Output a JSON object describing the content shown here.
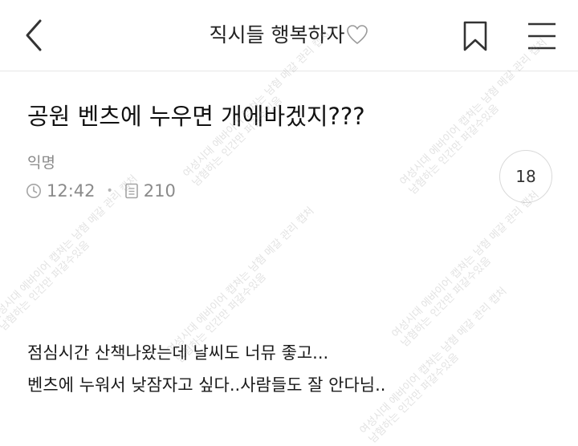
{
  "header": {
    "title": "직시들 행복하자",
    "back_icon": "chevron-left-icon",
    "title_icon": "white-heart-icon",
    "bookmark_icon": "bookmark-icon",
    "menu_icon": "hamburger-menu-icon"
  },
  "post": {
    "title": "공원 벤츠에 누우면 개에바겠지???",
    "author": "익명",
    "time_icon": "clock-icon",
    "time": "12:42",
    "views_icon": "document-icon",
    "views": "210",
    "comment_count": "18",
    "body": [
      "점심시간 산책나왔는데 날씨도 너뮤 좋고...",
      "벤츠에 누워서 낮잠자고 싶다..사람들도 잘 안다님.."
    ]
  },
  "watermark": {
    "line1": "여성시대 에바이어 캡쳐는 남혐 메갈 관리 캡처",
    "line2": "남혐하는 인간만 퍼갈수있음"
  }
}
